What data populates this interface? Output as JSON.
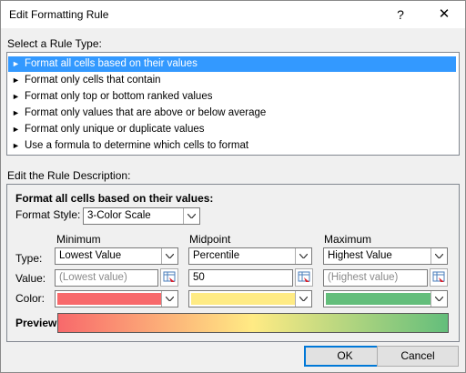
{
  "window": {
    "title": "Edit Formatting Rule",
    "help_glyph": "?",
    "close_glyph": "✕"
  },
  "rule_type": {
    "label": "Select a Rule Type:",
    "items": [
      "Format all cells based on their values",
      "Format only cells that contain",
      "Format only top or bottom ranked values",
      "Format only values that are above or below average",
      "Format only unique or duplicate values",
      "Use a formula to determine which cells to format"
    ],
    "selected_index": 0
  },
  "description": {
    "label": "Edit the Rule Description:",
    "heading": "Format all cells based on their values:",
    "format_style_label": "Format Style:",
    "format_style_value": "3-Color Scale",
    "columns": {
      "minimum": "Minimum",
      "midpoint": "Midpoint",
      "maximum": "Maximum"
    },
    "row_labels": {
      "type": "Type:",
      "value": "Value:",
      "color": "Color:"
    },
    "minimum": {
      "type": "Lowest Value",
      "value_placeholder": "(Lowest value)",
      "value": "",
      "color": "#f8696b"
    },
    "midpoint": {
      "type": "Percentile",
      "value_placeholder": "",
      "value": "50",
      "color": "#ffeb84"
    },
    "maximum": {
      "type": "Highest Value",
      "value_placeholder": "(Highest value)",
      "value": "",
      "color": "#63be7b"
    },
    "preview_label": "Preview:"
  },
  "buttons": {
    "ok": "OK",
    "cancel": "Cancel"
  }
}
